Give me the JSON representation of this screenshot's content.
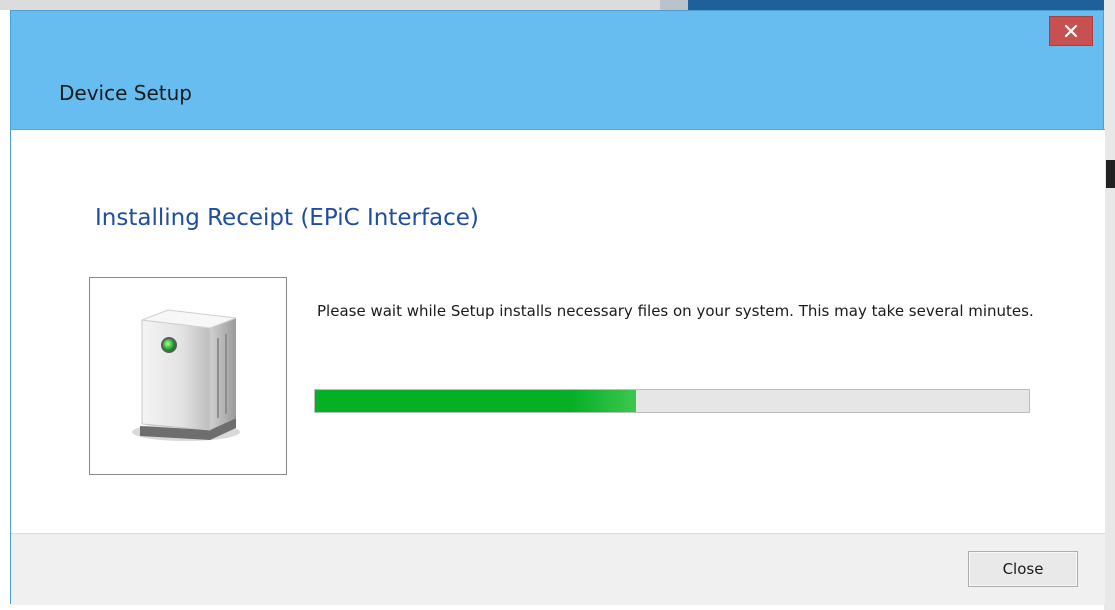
{
  "window": {
    "title": "Device Setup"
  },
  "content": {
    "heading": "Installing Receipt (EPiC Interface)",
    "message": "Please wait while Setup installs necessary files on your system. This may take several minutes.",
    "device_icon": "printer-device-icon",
    "progress_percent": 45
  },
  "footer": {
    "close_label": "Close"
  },
  "colors": {
    "titlebar": "#67bdf0",
    "heading": "#1f4ea0",
    "progress_fill": "#06b025",
    "close_x": "#c75050"
  }
}
